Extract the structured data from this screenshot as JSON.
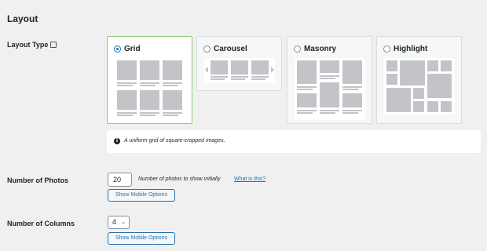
{
  "section_title": "Layout",
  "layout_type": {
    "label": "Layout Type",
    "options": [
      {
        "label": "Grid",
        "selected": true
      },
      {
        "label": "Carousel",
        "selected": false
      },
      {
        "label": "Masonry",
        "selected": false
      },
      {
        "label": "Highlight",
        "selected": false
      }
    ],
    "description": "A uniform grid of square-cropped images."
  },
  "number_of_photos": {
    "label": "Number of Photos",
    "value": "20",
    "hint": "Number of photos to show initially",
    "help_link": "What is this?",
    "mobile_button": "Show Mobile Options"
  },
  "number_of_columns": {
    "label": "Number of Columns",
    "value": "4",
    "mobile_button": "Show Mobile Options"
  },
  "colors": {
    "accent": "#2271b1",
    "selected_border": "#8fca76"
  }
}
